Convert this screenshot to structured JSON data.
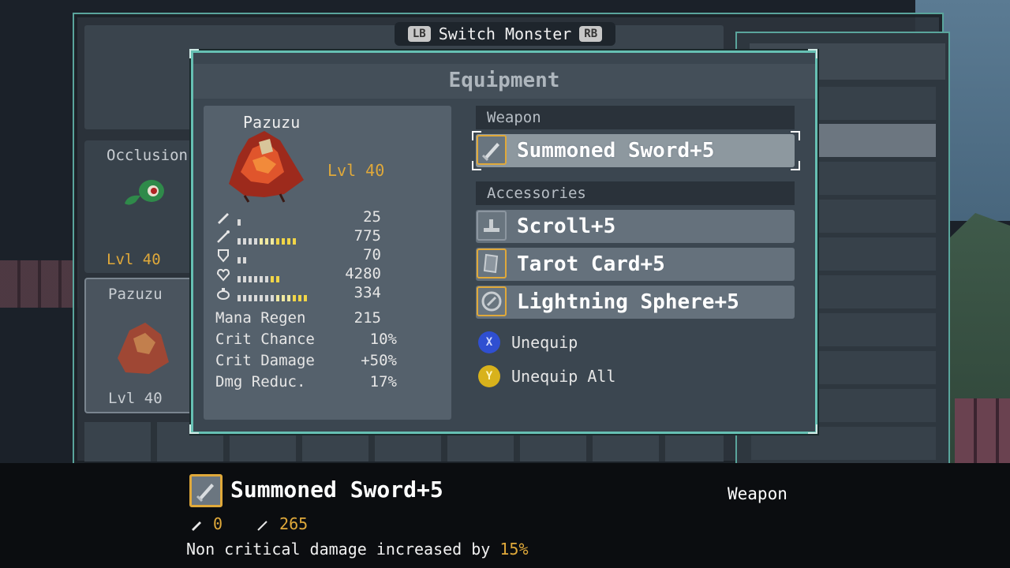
{
  "switch_bar": {
    "left_key": "LB",
    "label": "Switch Monster",
    "right_key": "RB"
  },
  "background": {
    "cards": [
      {
        "name": "Occlusion",
        "level": "Lvl 40"
      },
      {
        "name": "Pazuzu",
        "level": "Lvl 40"
      }
    ]
  },
  "equipment": {
    "title": "Equipment",
    "monster": {
      "name": "Pazuzu",
      "level": "Lvl 40"
    },
    "stats": [
      {
        "icon": "attack-icon",
        "value": "25",
        "segments": 1,
        "yellow": 0
      },
      {
        "icon": "magic-icon",
        "value": "775",
        "segments": 11,
        "yellow": 4
      },
      {
        "icon": "defense-icon",
        "value": "70",
        "segments": 2,
        "yellow": 0
      },
      {
        "icon": "health-icon",
        "value": "4280",
        "segments": 8,
        "yellow": 2
      },
      {
        "icon": "mana-icon",
        "value": "334",
        "segments": 13,
        "yellow": 3
      }
    ],
    "extra_stats": [
      {
        "label": "Mana Regen",
        "value": "215"
      },
      {
        "label": "Crit Chance",
        "value": "10%"
      },
      {
        "label": "Crit Damage",
        "value": "+50%"
      },
      {
        "label": "Dmg Reduc.",
        "value": "17%"
      }
    ],
    "weapon_header": "Weapon",
    "weapon": {
      "name": "Summoned Sword+5",
      "icon": "sword-icon"
    },
    "accessories_header": "Accessories",
    "accessories": [
      {
        "name": "Scroll+5",
        "icon": "scroll-icon"
      },
      {
        "name": "Tarot Card+5",
        "icon": "tarot-card-icon"
      },
      {
        "name": "Lightning Sphere+5",
        "icon": "lightning-sphere-icon"
      }
    ],
    "actions": [
      {
        "button": "X",
        "label": "Unequip",
        "color": "#2f4fd1"
      },
      {
        "button": "Y",
        "label": "Unequip All",
        "color": "#d8b21c"
      }
    ]
  },
  "tooltip": {
    "name": "Summoned Sword+5",
    "type": "Weapon",
    "attack": "0",
    "magic": "265",
    "description_prefix": "Non critical damage increased by ",
    "description_value": "15%"
  },
  "colors": {
    "accent": "#66c0b3",
    "gold": "#e0a93a"
  }
}
